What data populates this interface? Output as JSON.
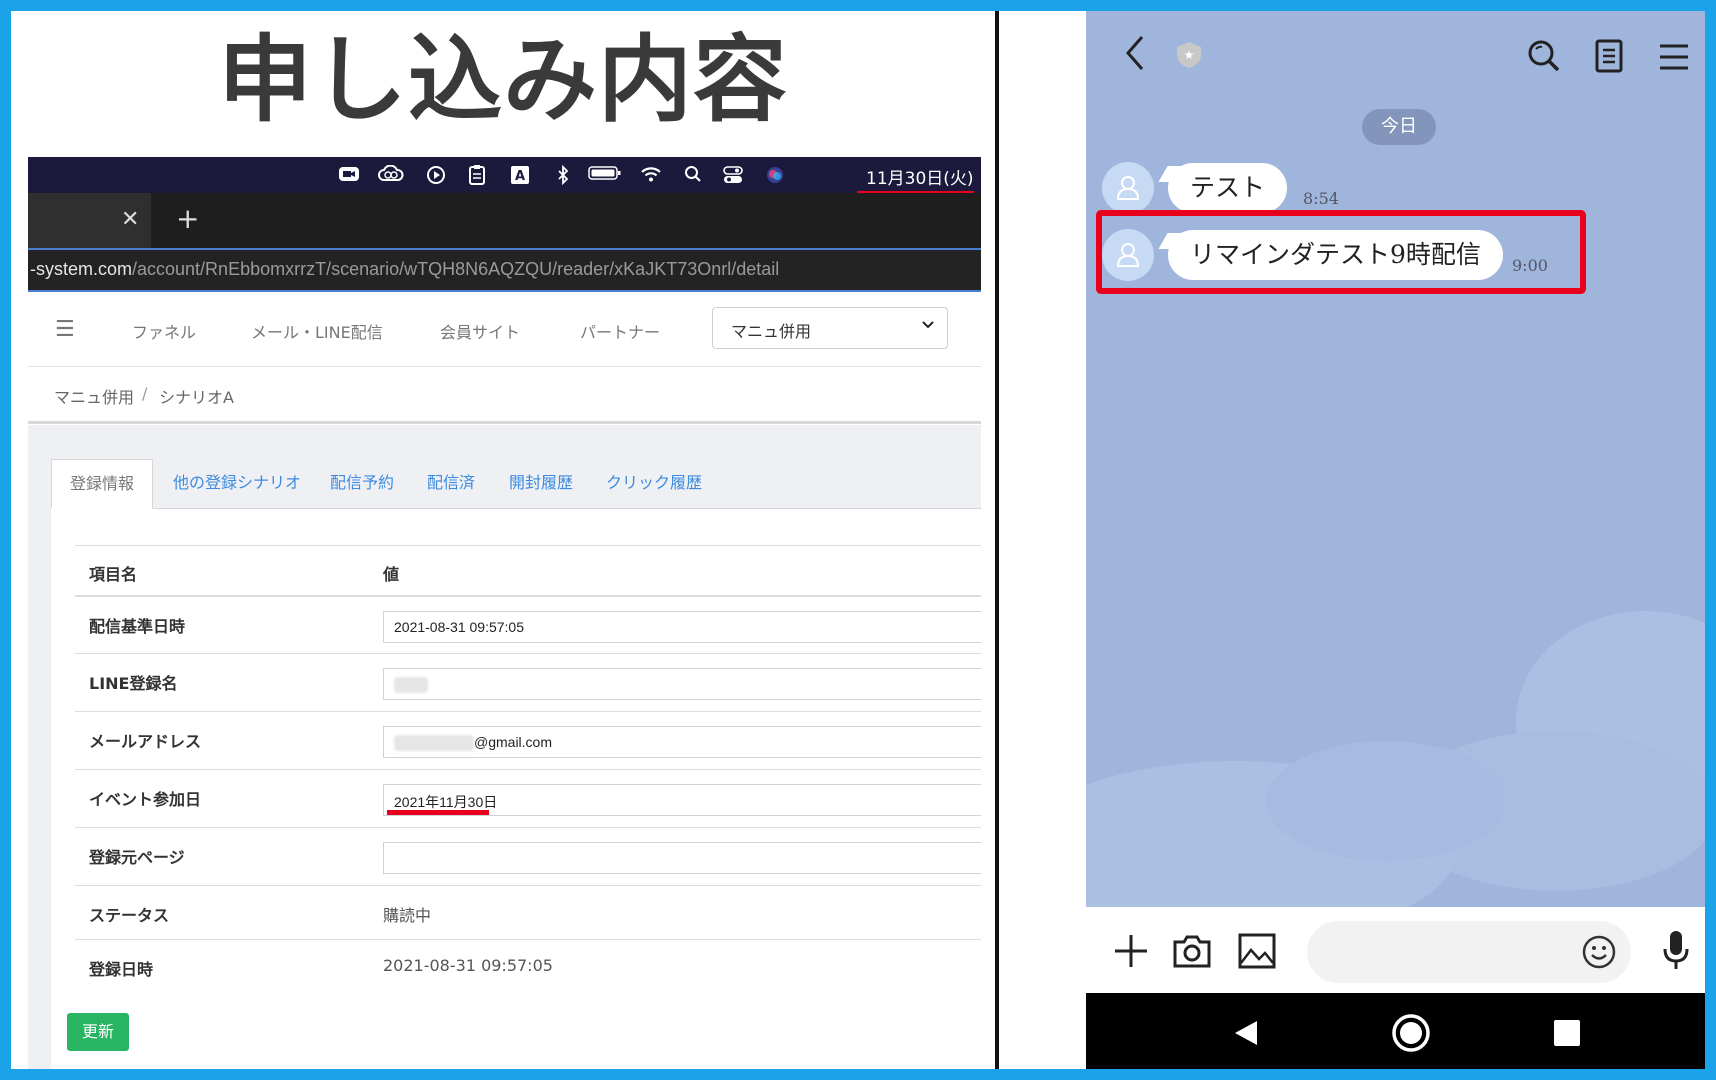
{
  "title": "申し込み内容",
  "menubar": {
    "date": "11月30日(火)",
    "icons": [
      "zoom-icon",
      "creative-cloud-icon",
      "play-icon",
      "clipboard-icon",
      "input-source-icon",
      "bluetooth-icon",
      "battery-icon",
      "wifi-icon",
      "spotlight-icon",
      "control-center-icon",
      "siri-icon"
    ]
  },
  "browser": {
    "url_domain": "-system.com",
    "url_path": "/account/RnEbbomxrrzT/scenario/wTQH8N6AQZQU/reader/xKaJKT73Onrl/detail"
  },
  "nav": {
    "items": [
      "ファネル",
      "メール・LINE配信",
      "会員サイト",
      "パートナー"
    ],
    "select_value": "マニュ併用"
  },
  "breadcrumb": {
    "first": "マニュ併用",
    "separator": "/",
    "second": "シナリオA"
  },
  "tabs": [
    "登録情報",
    "他の登録シナリオ",
    "配信予約",
    "配信済",
    "開封履歴",
    "クリック履歴"
  ],
  "table": {
    "header": {
      "name": "項目名",
      "value": "値"
    },
    "rows": [
      {
        "label": "配信基準日時",
        "value": "2021-08-31 09:57:05"
      },
      {
        "label": "LINE登録名",
        "value": ""
      },
      {
        "label": "メールアドレス",
        "value": "@gmail.com"
      },
      {
        "label": "イベント参加日",
        "value": "2021年11月30日"
      },
      {
        "label": "登録元ページ",
        "value": ""
      },
      {
        "label": "ステータス",
        "value": "購読中"
      },
      {
        "label": "登録日時",
        "value": "2021-08-31 09:57:05"
      }
    ]
  },
  "update_button": "更新",
  "line_chat": {
    "date_chip": "今日",
    "messages": [
      {
        "text": "テスト",
        "time": "8:54"
      },
      {
        "text": "リマインダテスト9時配信",
        "time": "9:00"
      }
    ]
  },
  "colors": {
    "frame": "#1aa3e8",
    "highlight": "#e8001c",
    "chat_bg": "#9fb5dc",
    "link": "#3d8be0",
    "update_button": "#28b463"
  }
}
